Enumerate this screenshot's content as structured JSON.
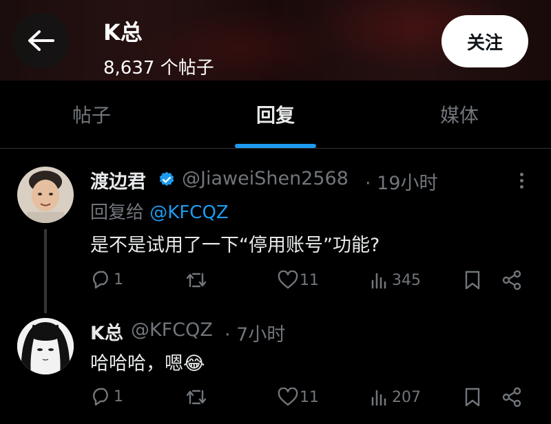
{
  "header": {
    "title": "K总",
    "post_count": "8,637 个帖子",
    "follow_label": "关注"
  },
  "tabs": [
    {
      "label": "帖子",
      "active": false
    },
    {
      "label": "回复",
      "active": true
    },
    {
      "label": "媒体",
      "active": false
    }
  ],
  "posts": [
    {
      "author": "渡边君",
      "verified": true,
      "handle": "@JiaweiShen2568",
      "time": "· 19小时",
      "reply_prefix": "回复给",
      "reply_handle": "@KFCQZ",
      "text": "是不是试用了一下“停用账号”功能?",
      "actions": {
        "replies": "1",
        "reposts": "",
        "likes": "11",
        "views": "345"
      }
    },
    {
      "author": "K总",
      "verified": false,
      "handle": "@KFCQZ",
      "time": "· 7小时",
      "text": "哈哈哈，嗯😂",
      "actions": {
        "replies": "1",
        "reposts": "",
        "likes": "11",
        "views": "207"
      }
    }
  ],
  "colors": {
    "accent": "#1d9bf0",
    "muted": "#71767b",
    "text": "#e7e9ea",
    "background": "#000000"
  }
}
